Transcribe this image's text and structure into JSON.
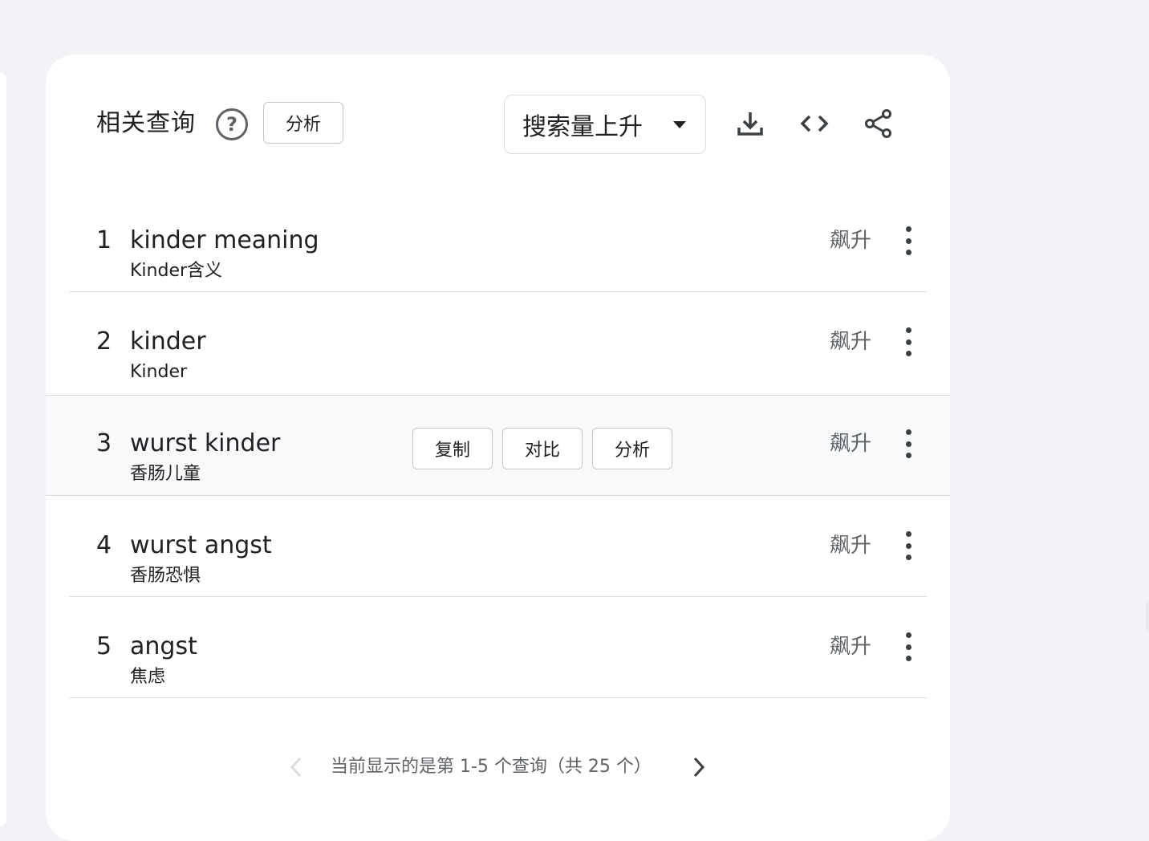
{
  "card": {
    "title": "相关查询",
    "help_icon": "help-circle-icon",
    "analyze_label": "分析",
    "sort": {
      "selected": "搜索量上升"
    },
    "tools": {
      "download": "download-icon",
      "embed": "code-icon",
      "share": "share-icon"
    }
  },
  "rows": [
    {
      "rank": "1",
      "query": "kinder meaning",
      "translation": "Kinder含义",
      "value": "飙升"
    },
    {
      "rank": "2",
      "query": "kinder",
      "translation": "Kinder",
      "value": "飙升"
    },
    {
      "rank": "3",
      "query": "wurst kinder",
      "translation": "香肠儿童",
      "value": "飙升",
      "actions": {
        "copy": "复制",
        "compare": "对比",
        "analyze": "分析"
      }
    },
    {
      "rank": "4",
      "query": "wurst angst",
      "translation": "香肠恐惧",
      "value": "飙升"
    },
    {
      "rank": "5",
      "query": "angst",
      "translation": "焦虑",
      "value": "飙升"
    }
  ],
  "pagination": {
    "label": "当前显示的是第 1-5 个查询（共 25 个）"
  },
  "colors": {
    "background": "#f1f3f6",
    "card": "#ffffff",
    "hover_row": "#f8f9fa",
    "muted_text": "#5f6368"
  }
}
